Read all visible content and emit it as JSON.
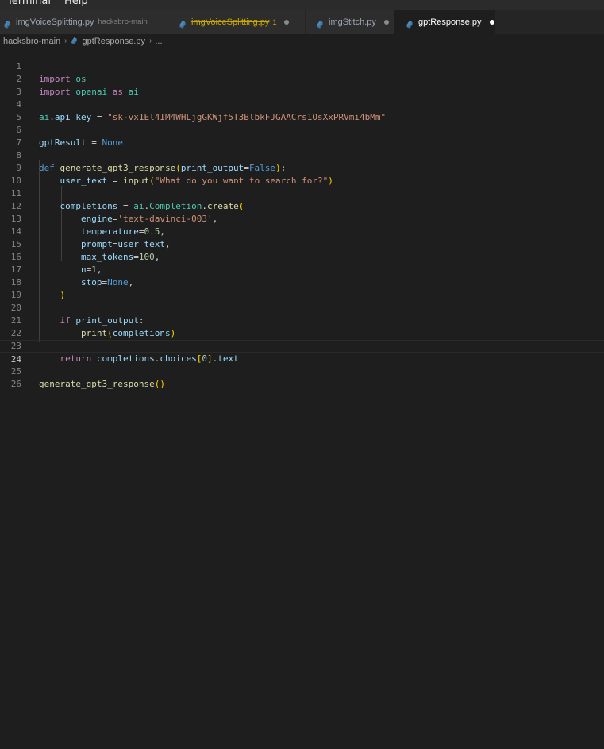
{
  "menubar": {
    "items": [
      "Terminal",
      "Help"
    ]
  },
  "tabs": [
    {
      "label": "imgVoiceSplitting.py",
      "description": "hacksbro-main",
      "dirty": false,
      "active": false,
      "has_problem": false
    },
    {
      "label": "imgVoiceSplitting.py",
      "problem_count": "1",
      "dirty": true,
      "active": false,
      "has_problem": true
    },
    {
      "label": "imgStitch.py",
      "dirty": true,
      "active": false,
      "has_problem": false
    },
    {
      "label": "gptResponse.py",
      "dirty": true,
      "active": true,
      "has_problem": false
    }
  ],
  "breadcrumb": {
    "folder": "hacksbro-main",
    "file": "gptResponse.py",
    "symbol": "..."
  },
  "editor": {
    "current_line": 24,
    "line_numbers": [
      "1",
      "2",
      "3",
      "4",
      "5",
      "6",
      "7",
      "8",
      "9",
      "10",
      "11",
      "12",
      "13",
      "14",
      "15",
      "16",
      "17",
      "18",
      "19",
      "20",
      "21",
      "22",
      "23",
      "24",
      "25",
      "26"
    ],
    "tokens": {
      "import": "import",
      "os": "os",
      "openai": "openai",
      "as": "as",
      "ai": "ai",
      "dot": ".",
      "api_key": "api_key",
      "eq": " = ",
      "api_key_value": "\"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\"",
      "gptResult": "gptResult",
      "None": "None",
      "def": "def",
      "fn_name": "generate_gpt3_response",
      "lparen": "(",
      "rparen": ")",
      "colon": ":",
      "print_output": "print_output",
      "eq_tight": "=",
      "False": "False",
      "user_text": "user_text",
      "input": "input",
      "prompt_str": "\"What do you want to search for?\"",
      "completions": "completions",
      "Completion": "Completion",
      "create": "create",
      "engine": "engine",
      "engine_val": "'text-davinci-003'",
      "comma": ",",
      "temperature": "temperature",
      "temp_val": "0.5",
      "prompt": "prompt",
      "max_tokens": "max_tokens",
      "max_val": "100",
      "n": "n",
      "n_val": "1",
      "stop": "stop",
      "if": "if",
      "print": "print",
      "return": "return",
      "choices": "choices",
      "lbr": "[",
      "idx": "0",
      "rbr": "]",
      "text": "text"
    }
  }
}
